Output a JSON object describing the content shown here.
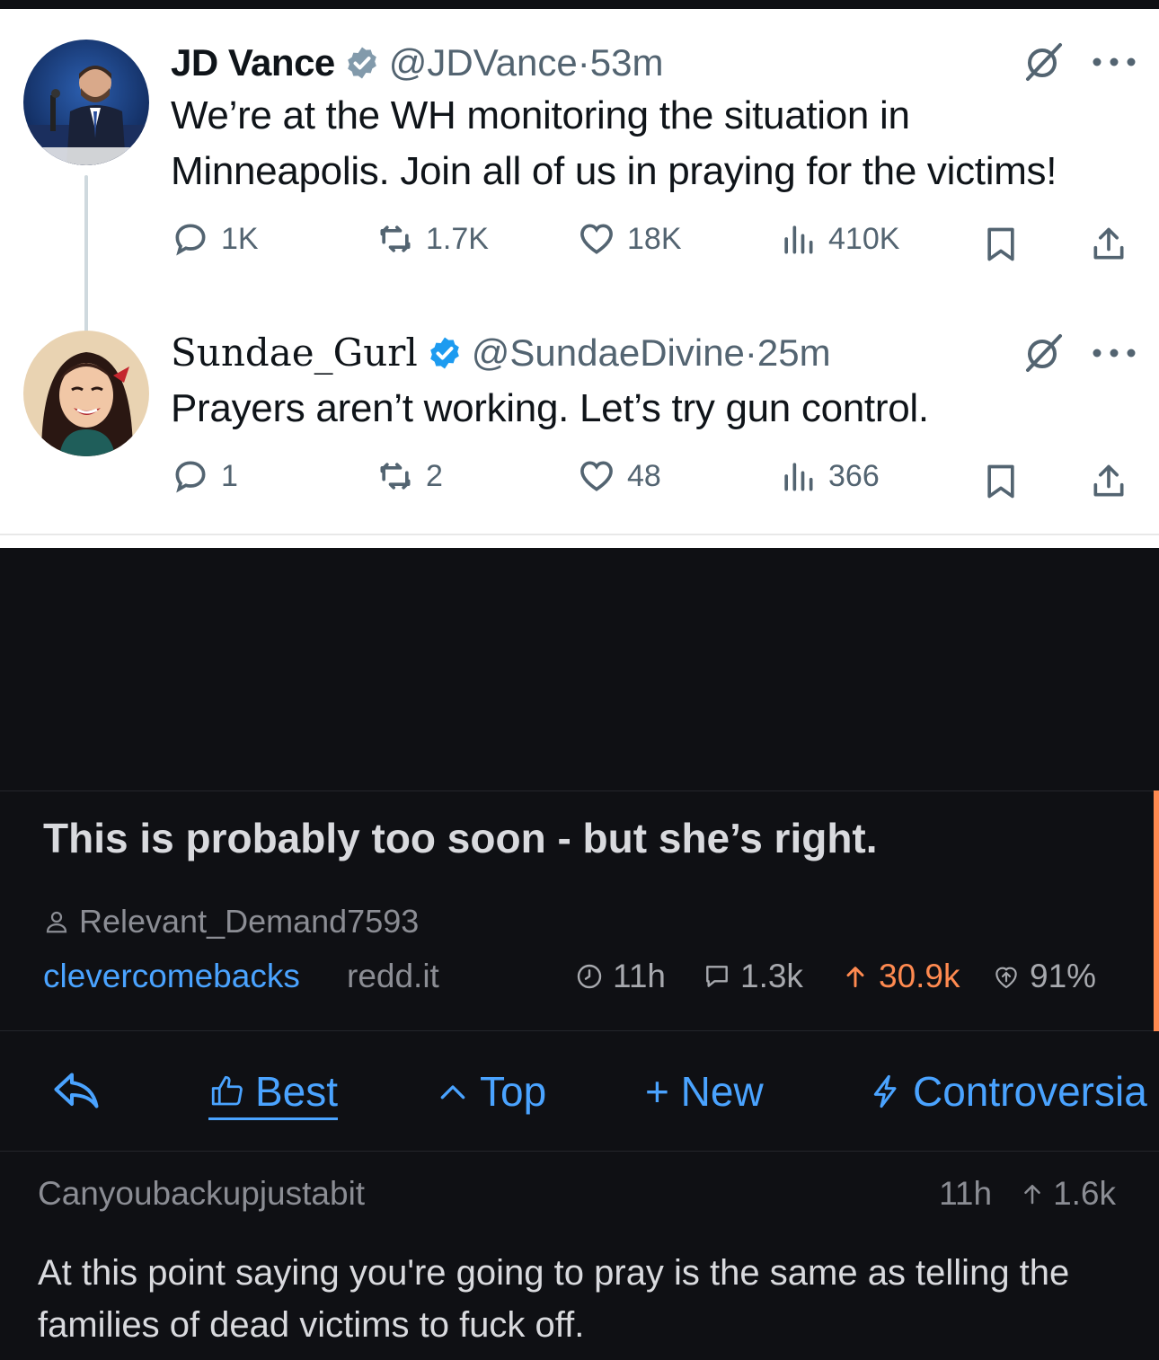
{
  "tweets": [
    {
      "name": "JD Vance",
      "handle": "@JDVance",
      "sep": " · ",
      "time": "53m",
      "text_line1": "We’re at the WH monitoring the situation in",
      "text_line2": "Minneapolis. Join all of us in praying for the victims!",
      "replies": "1K",
      "reposts": "1.7K",
      "likes": "18K",
      "views": "410K"
    },
    {
      "name": "Sundae_Gurl",
      "handle": "@SundaeDivine",
      "sep": " · ",
      "time": "25m",
      "text_line1": "Prayers aren’t working. Let’s try gun control.",
      "replies": "1",
      "reposts": "2",
      "likes": "48",
      "views": "366"
    }
  ],
  "post": {
    "title": "This is probably too soon - but she’s right.",
    "author": "Relevant_Demand7593",
    "subreddit": "clevercomebacks",
    "domain": "redd.it",
    "age": "11h",
    "comments": "1.3k",
    "score": "30.9k",
    "upvote_ratio": "91%"
  },
  "sort": {
    "best": "Best",
    "top": "Top",
    "new": "+ New",
    "controversial": "Controversia"
  },
  "comment": {
    "author": "Canyoubackupjustabit",
    "age": "11h",
    "score": "1.6k",
    "body": "At this point saying you're going to pray is the same as telling the families of dead victims to fuck off."
  },
  "colors": {
    "link_blue": "#4aa3ff",
    "accent_orange": "#ff8a50",
    "twitter_verified": "#1d9bf0",
    "dark_bg": "#0f1014"
  }
}
